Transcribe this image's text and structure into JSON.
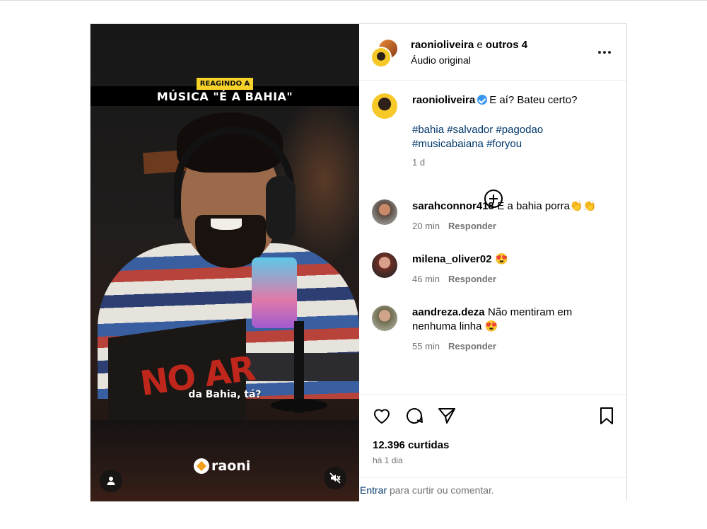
{
  "media": {
    "tag": "REAGINDO A",
    "title": "MÚSICA \"É A BAHIA\"",
    "subtitle": "da Bahia, tá?",
    "sign_text": "NO AR",
    "logo_text": "raoni",
    "user_icon": "user-icon",
    "mute_icon": "speaker-muted-icon"
  },
  "header": {
    "user": "raonioliveira",
    "conjunction": "e",
    "others": "outros 4",
    "audio": "Áudio original",
    "more_icon": "more-icon"
  },
  "caption": {
    "user": "raonioliveira",
    "text": "E aí? Bateu certo?",
    "hashtags_line1": "#bahia #salvador #pagodao",
    "hashtags_line2": "#musicabaiana #foryou",
    "time": "1 d",
    "load_more_icon": "plus-circle-icon"
  },
  "comments": [
    {
      "user": "sarahconnor418",
      "text": "É a bahia porra👏👏",
      "time": "20 min",
      "reply": "Responder"
    },
    {
      "user": "milena_oliver02",
      "text": "😍",
      "time": "46 min",
      "reply": "Responder"
    },
    {
      "user": "aandreza.deza",
      "text": "Não mentiram em nenhuma linha 😍",
      "time": "55 min",
      "reply": "Responder"
    }
  ],
  "actions": {
    "likes": "12.396 curtidas",
    "ago": "há 1 dia"
  },
  "login": {
    "link": "Entrar",
    "rest": " para curtir ou comentar."
  },
  "colors": {
    "link": "#00376b",
    "verified": "#3897f0",
    "muted_text": "#737373",
    "tag_bg": "#f7d32a",
    "border": "#dbdbdb"
  }
}
